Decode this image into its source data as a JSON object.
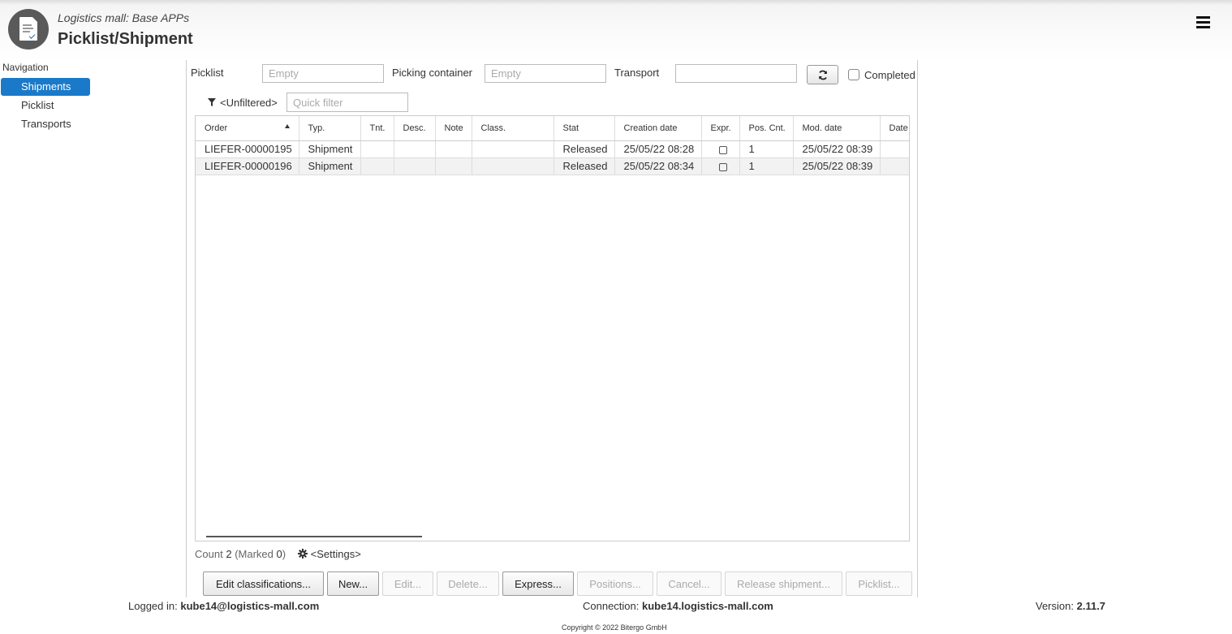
{
  "header": {
    "subtitle": "Logistics mall: Base APPs",
    "title": "Picklist/Shipment",
    "logo_icon": "document-check-icon",
    "menu_icon": "hamburger-icon"
  },
  "navigation": {
    "title": "Navigation",
    "items": [
      {
        "label": "Shipments",
        "active": true
      },
      {
        "label": "Picklist",
        "active": false
      },
      {
        "label": "Transports",
        "active": false
      }
    ]
  },
  "filters": {
    "picklist_label": "Picklist",
    "picklist_placeholder": "Empty",
    "picking_container_label": "Picking container",
    "picking_container_placeholder": "Empty",
    "transport_label": "Transport",
    "transport_value": "",
    "refresh_icon": "refresh-icon",
    "completed_label": "Completed",
    "unfiltered_label": "<Unfiltered>",
    "quick_filter_placeholder": "Quick filter"
  },
  "table": {
    "columns": [
      "Order",
      "Typ.",
      "Tnt.",
      "Desc.",
      "Note",
      "Class.",
      "Stat",
      "Creation date",
      "Expr.",
      "Pos. Cnt.",
      "Mod. date",
      "Date"
    ],
    "rows": [
      {
        "order": "LIEFER-00000195",
        "typ": "Shipment",
        "tnt": "",
        "desc": "",
        "note": "",
        "class": "",
        "stat": "Released",
        "creation": "25/05/22 08:28",
        "expr": false,
        "pos": "1",
        "mod": "25/05/22 08:39",
        "date": ""
      },
      {
        "order": "LIEFER-00000196",
        "typ": "Shipment",
        "tnt": "",
        "desc": "",
        "note": "",
        "class": "",
        "stat": "Released",
        "creation": "25/05/22 08:34",
        "expr": false,
        "pos": "1",
        "mod": "25/05/22 08:39",
        "date": ""
      }
    ]
  },
  "status": {
    "count_label": "Count",
    "count_value": "2",
    "marked_label": "(Marked",
    "marked_value": "0",
    "marked_close": ")",
    "settings_label": "<Settings>",
    "settings_icon": "gear-icon"
  },
  "buttons": [
    {
      "label": "Edit classifications...",
      "enabled": true
    },
    {
      "label": "New...",
      "enabled": true
    },
    {
      "label": "Edit...",
      "enabled": false
    },
    {
      "label": "Delete...",
      "enabled": false
    },
    {
      "label": "Express...",
      "enabled": true
    },
    {
      "label": "Positions...",
      "enabled": false
    },
    {
      "label": "Cancel...",
      "enabled": false
    },
    {
      "label": "Release shipment...",
      "enabled": false
    },
    {
      "label": "Picklist...",
      "enabled": false
    }
  ],
  "footer": {
    "logged_in_label": "Logged in:",
    "logged_in_value": "kube14@logistics-mall.com",
    "connection_label": "Connection:",
    "connection_value": "kube14.logistics-mall.com",
    "version_label": "Version:",
    "version_value": "2.11.7",
    "copyright": "Copyright © 2022 Bitergo GmbH"
  }
}
